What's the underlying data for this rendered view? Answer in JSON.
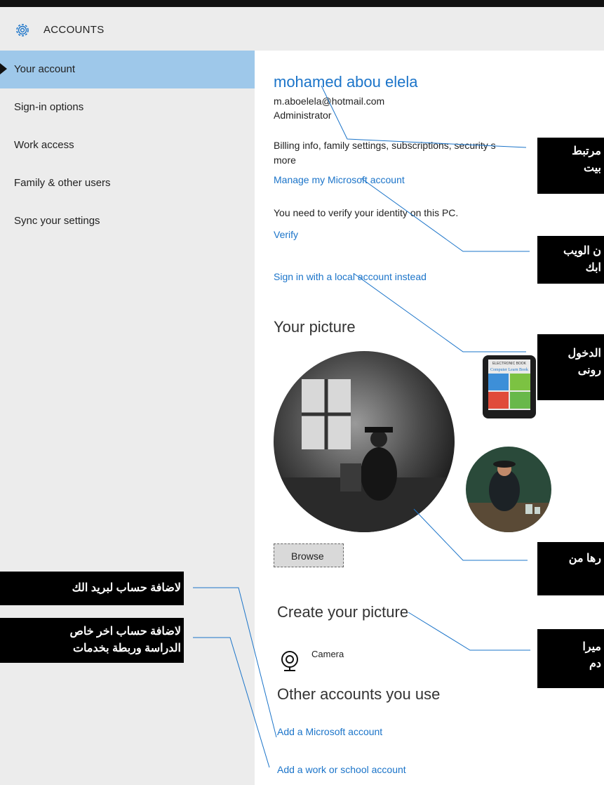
{
  "header": {
    "title": "ACCOUNTS",
    "icon": "gear-icon"
  },
  "sidebar": {
    "items": [
      {
        "label": "Your account",
        "active": true
      },
      {
        "label": "Sign-in options"
      },
      {
        "label": "Work access"
      },
      {
        "label": "Family & other users"
      },
      {
        "label": "Sync your settings"
      }
    ]
  },
  "account": {
    "name": "mohamed abou elela",
    "email": "m.aboelela@hotmail.com",
    "role": "Administrator",
    "billing_text_line1": "Billing info, family settings, subscriptions, security s",
    "billing_text_line2": "more",
    "manage_link": "Manage my Microsoft account",
    "verify_text": "You need to verify your identity on this PC.",
    "verify_link": "Verify",
    "local_account_link": "Sign in with a local account instead"
  },
  "picture": {
    "heading": "Your picture",
    "browse_label": "Browse",
    "book_cover": {
      "line1": "ELECTRONIC BOOK",
      "line2": "Computer Learn Book"
    }
  },
  "create_picture": {
    "heading": "Create your picture",
    "camera_label": "Camera"
  },
  "other_accounts": {
    "heading": "Other accounts you use",
    "add_microsoft_link": "Add a Microsoft account",
    "add_work_link": "Add a work or school account"
  },
  "callouts": {
    "c1_line1": "مرتبط",
    "c1_line2": "بيت",
    "c2_line1": "ن الويب",
    "c2_line2": "ابك",
    "c3_line1": "الدخول",
    "c3_line2": "رونى",
    "c4_line1": "رها من",
    "c4_line2": "",
    "c5_line1": "لاضافة حساب لبريد الك",
    "c6_line1": "لاضافة حساب اخر خاص",
    "c6_line2": "الدراسة وربطة بخدمات",
    "c7_line1": "ميرا",
    "c7_line2": "دم"
  },
  "colors": {
    "accent": "#1b74c9",
    "active_nav": "#9ec8ea",
    "callout_bg": "#000000",
    "leader_line": "#1b74c9"
  }
}
